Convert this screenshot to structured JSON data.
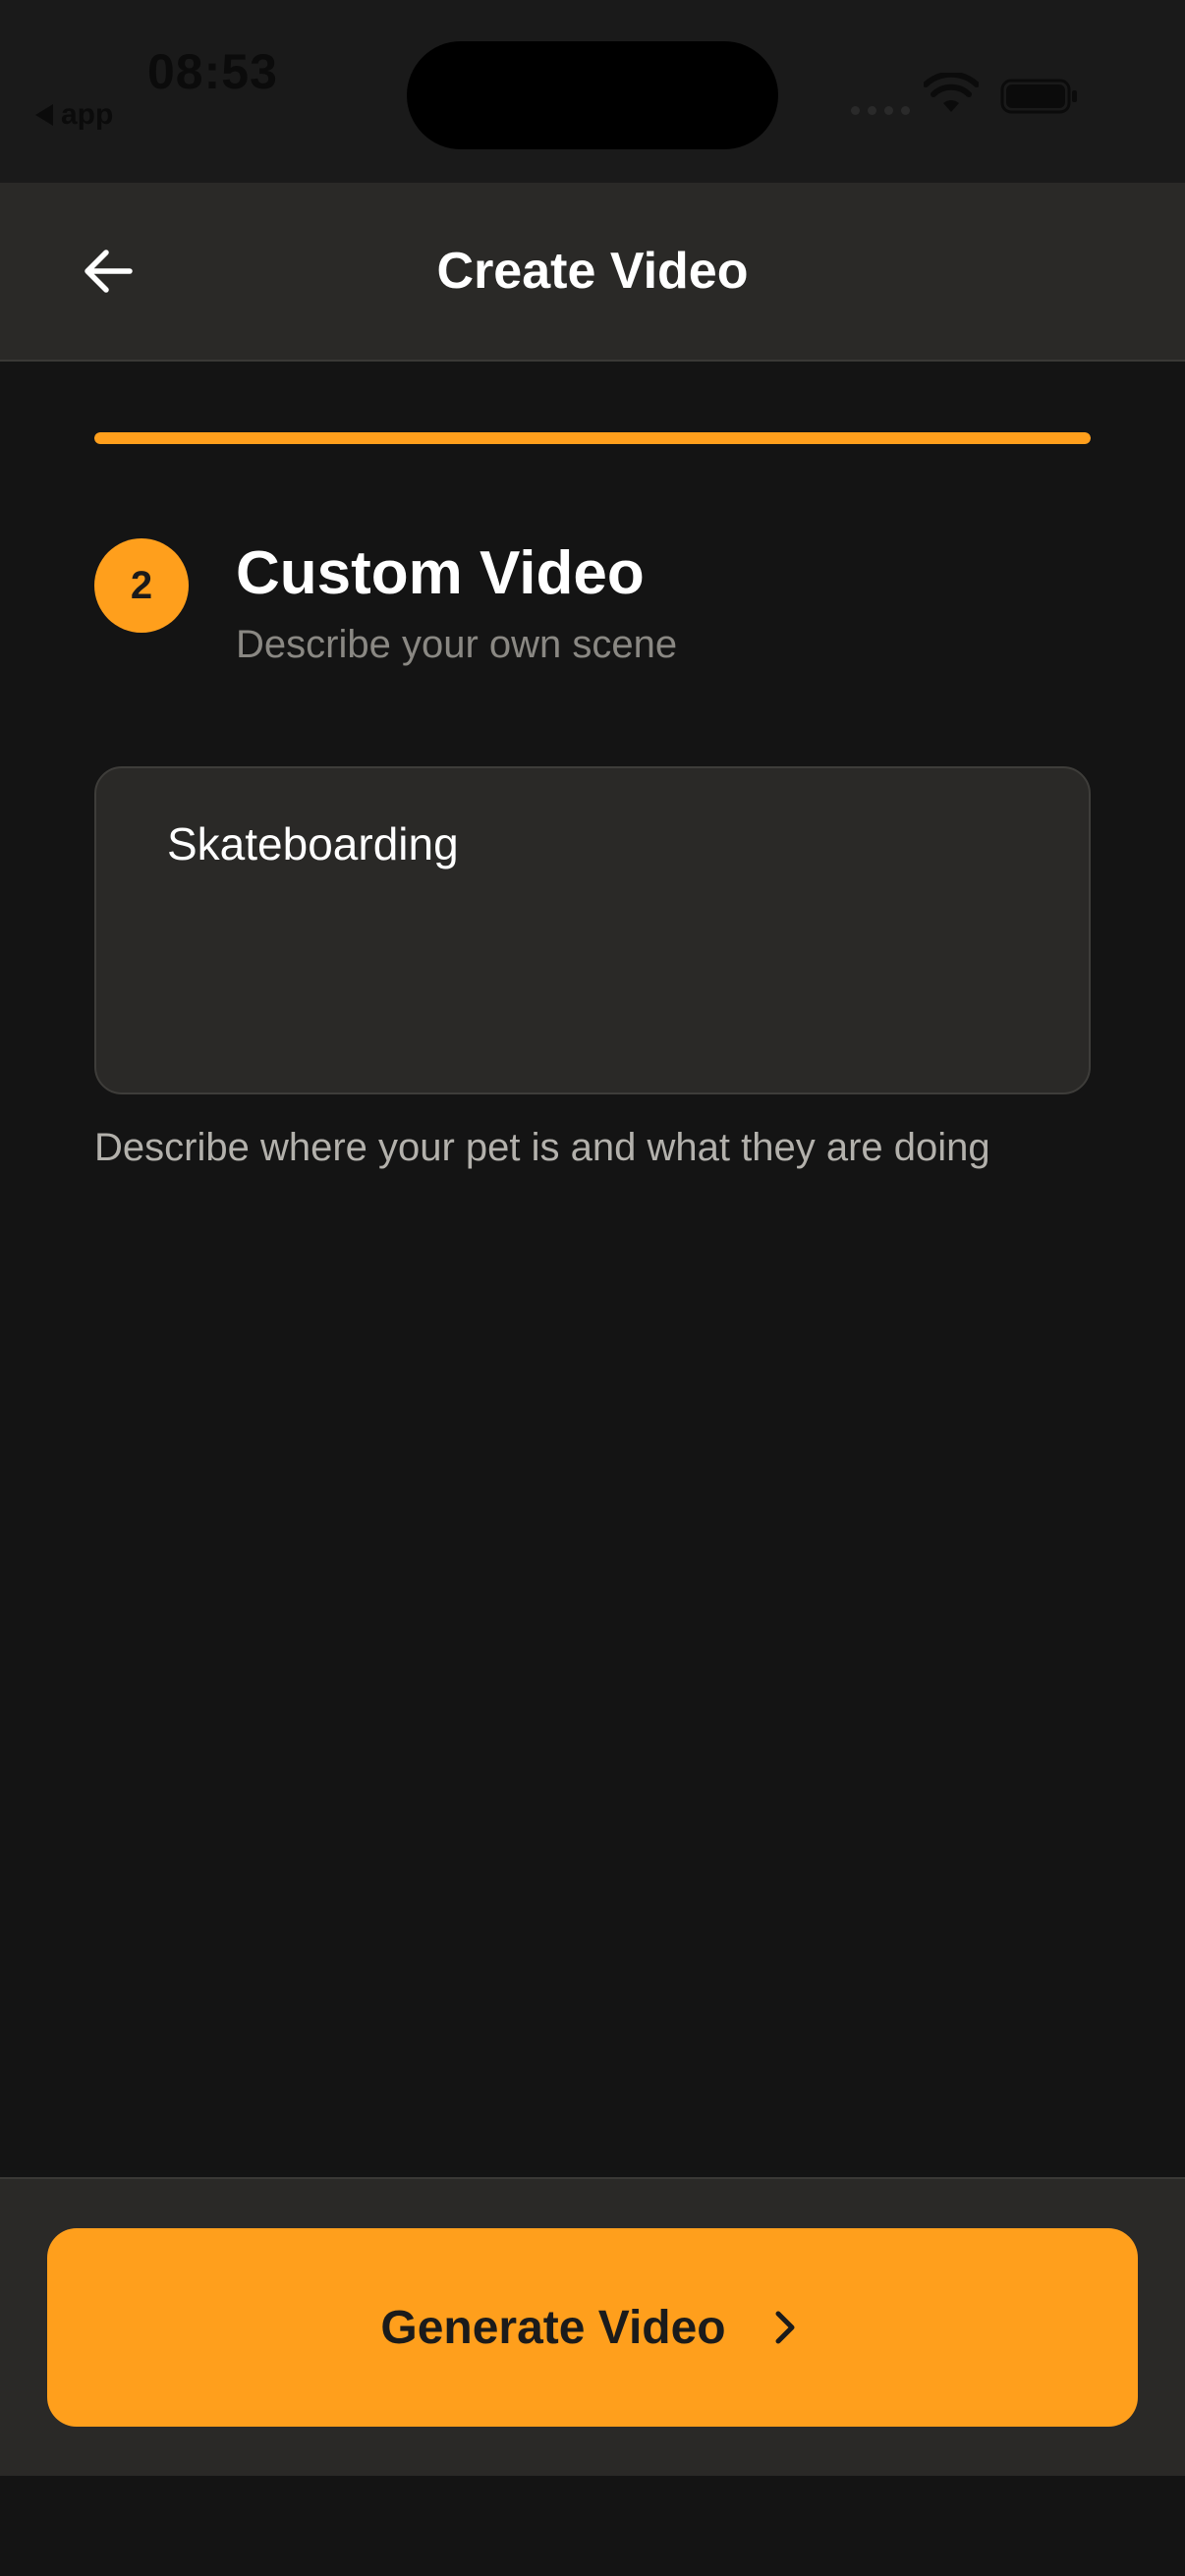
{
  "status_bar": {
    "time": "08:53",
    "back_app": "app",
    "icons": [
      "wifi-icon",
      "battery-icon"
    ]
  },
  "header": {
    "title": "Create Video",
    "back_icon": "arrow-left-icon"
  },
  "progress": {
    "value_percent": 100
  },
  "step": {
    "number": "2",
    "title": "Custom Video",
    "subtitle": "Describe your own scene"
  },
  "prompt": {
    "value": "Skateboarding",
    "helper": "Describe where your pet is and what they are doing"
  },
  "footer": {
    "button_label": "Generate Video",
    "button_icon": "chevron-right-icon"
  },
  "colors": {
    "accent": "#ff9f1c",
    "background": "#141414",
    "surface": "#2a2927",
    "muted_text": "#8a8883"
  }
}
